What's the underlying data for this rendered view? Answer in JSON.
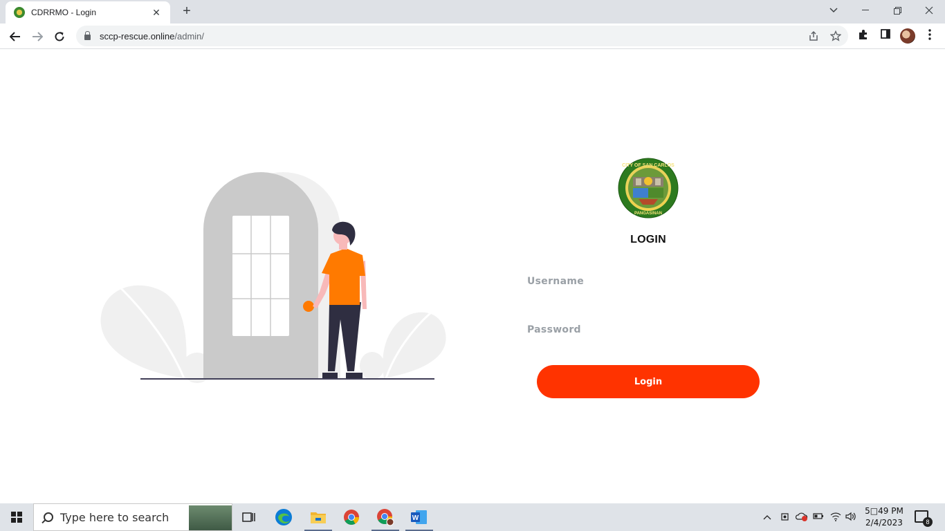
{
  "browser": {
    "tab_title": "CDRRMO - Login",
    "tab_close": "✕",
    "new_tab": "+",
    "url_host": "sccp-rescue.online",
    "url_path": "/admin/"
  },
  "page": {
    "seal_text_top": "CITY OF SAN CARLOS",
    "seal_text_bottom": "PANGASINAN",
    "login_title": "LOGIN",
    "username_placeholder": "Username",
    "password_placeholder": "Password",
    "login_button": "Login",
    "accent_color": "#ff3300"
  },
  "taskbar": {
    "search_placeholder": "Type here to search",
    "time": "5□49 PM",
    "date": "2/4/2023",
    "notification_count": "8",
    "apps": [
      "task-view",
      "edge",
      "file-explorer",
      "chrome",
      "chrome-profile",
      "word"
    ]
  }
}
